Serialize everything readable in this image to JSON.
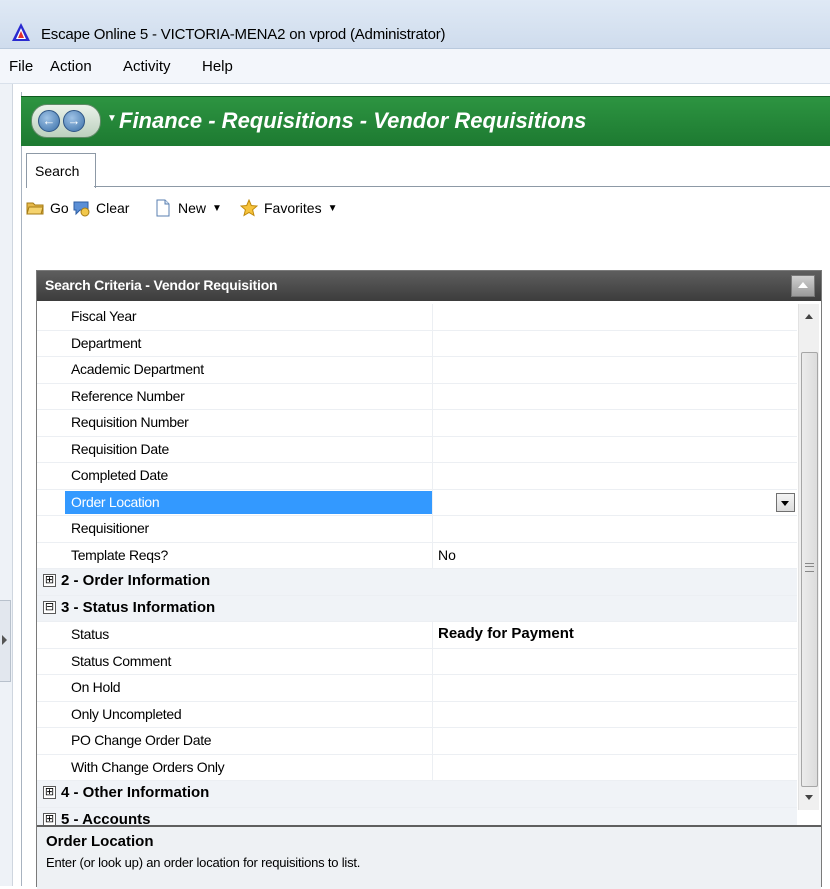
{
  "window": {
    "title": "Escape Online 5 - VICTORIA-MENA2 on vprod (Administrator)",
    "icon": "escape-logo-icon"
  },
  "menu": {
    "items": [
      "File",
      "Action",
      "Activity",
      "Help"
    ]
  },
  "header": {
    "title": "Finance - Requisitions - Vendor Requisitions",
    "back_icon": "back-arrow-icon",
    "forward_icon": "forward-arrow-icon"
  },
  "tabs": [
    {
      "label": "Search",
      "active": true
    }
  ],
  "toolbar": {
    "go_label": "Go",
    "clear_label": "Clear",
    "new_label": "New",
    "favorites_label": "Favorites"
  },
  "panel": {
    "title": "Search Criteria - Vendor Requisition",
    "rows": [
      {
        "type": "field",
        "label": "Fiscal Year",
        "value": ""
      },
      {
        "type": "field",
        "label": "Department",
        "value": ""
      },
      {
        "type": "field",
        "label": "Academic Department",
        "value": ""
      },
      {
        "type": "field",
        "label": "Reference Number",
        "value": ""
      },
      {
        "type": "field",
        "label": "Requisition Number",
        "value": ""
      },
      {
        "type": "field",
        "label": "Requisition Date",
        "value": ""
      },
      {
        "type": "field",
        "label": "Completed Date",
        "value": ""
      },
      {
        "type": "field",
        "label": "Order Location",
        "value": "",
        "selected": true
      },
      {
        "type": "field",
        "label": "Requisitioner",
        "value": ""
      },
      {
        "type": "field",
        "label": "Template Reqs?",
        "value": "No"
      },
      {
        "type": "section",
        "label": "2 - Order Information",
        "expander": "⊞"
      },
      {
        "type": "section",
        "label": "3 - Status Information",
        "expander": "⊟"
      },
      {
        "type": "field",
        "label": "Status",
        "value": "Ready for Payment",
        "bold_value": true
      },
      {
        "type": "field",
        "label": "Status Comment",
        "value": ""
      },
      {
        "type": "field",
        "label": "On Hold",
        "value": ""
      },
      {
        "type": "field",
        "label": "Only Uncompleted",
        "value": ""
      },
      {
        "type": "field",
        "label": "PO Change Order Date",
        "value": ""
      },
      {
        "type": "field",
        "label": "With Change Orders Only",
        "value": ""
      },
      {
        "type": "section",
        "label": "4 - Other Information",
        "expander": "⊞"
      },
      {
        "type": "section",
        "label": "5 - Accounts",
        "expander": "⊞"
      }
    ]
  },
  "description": {
    "title": "Order Location",
    "text": "Enter (or look up) an order location for requisitions to list."
  }
}
